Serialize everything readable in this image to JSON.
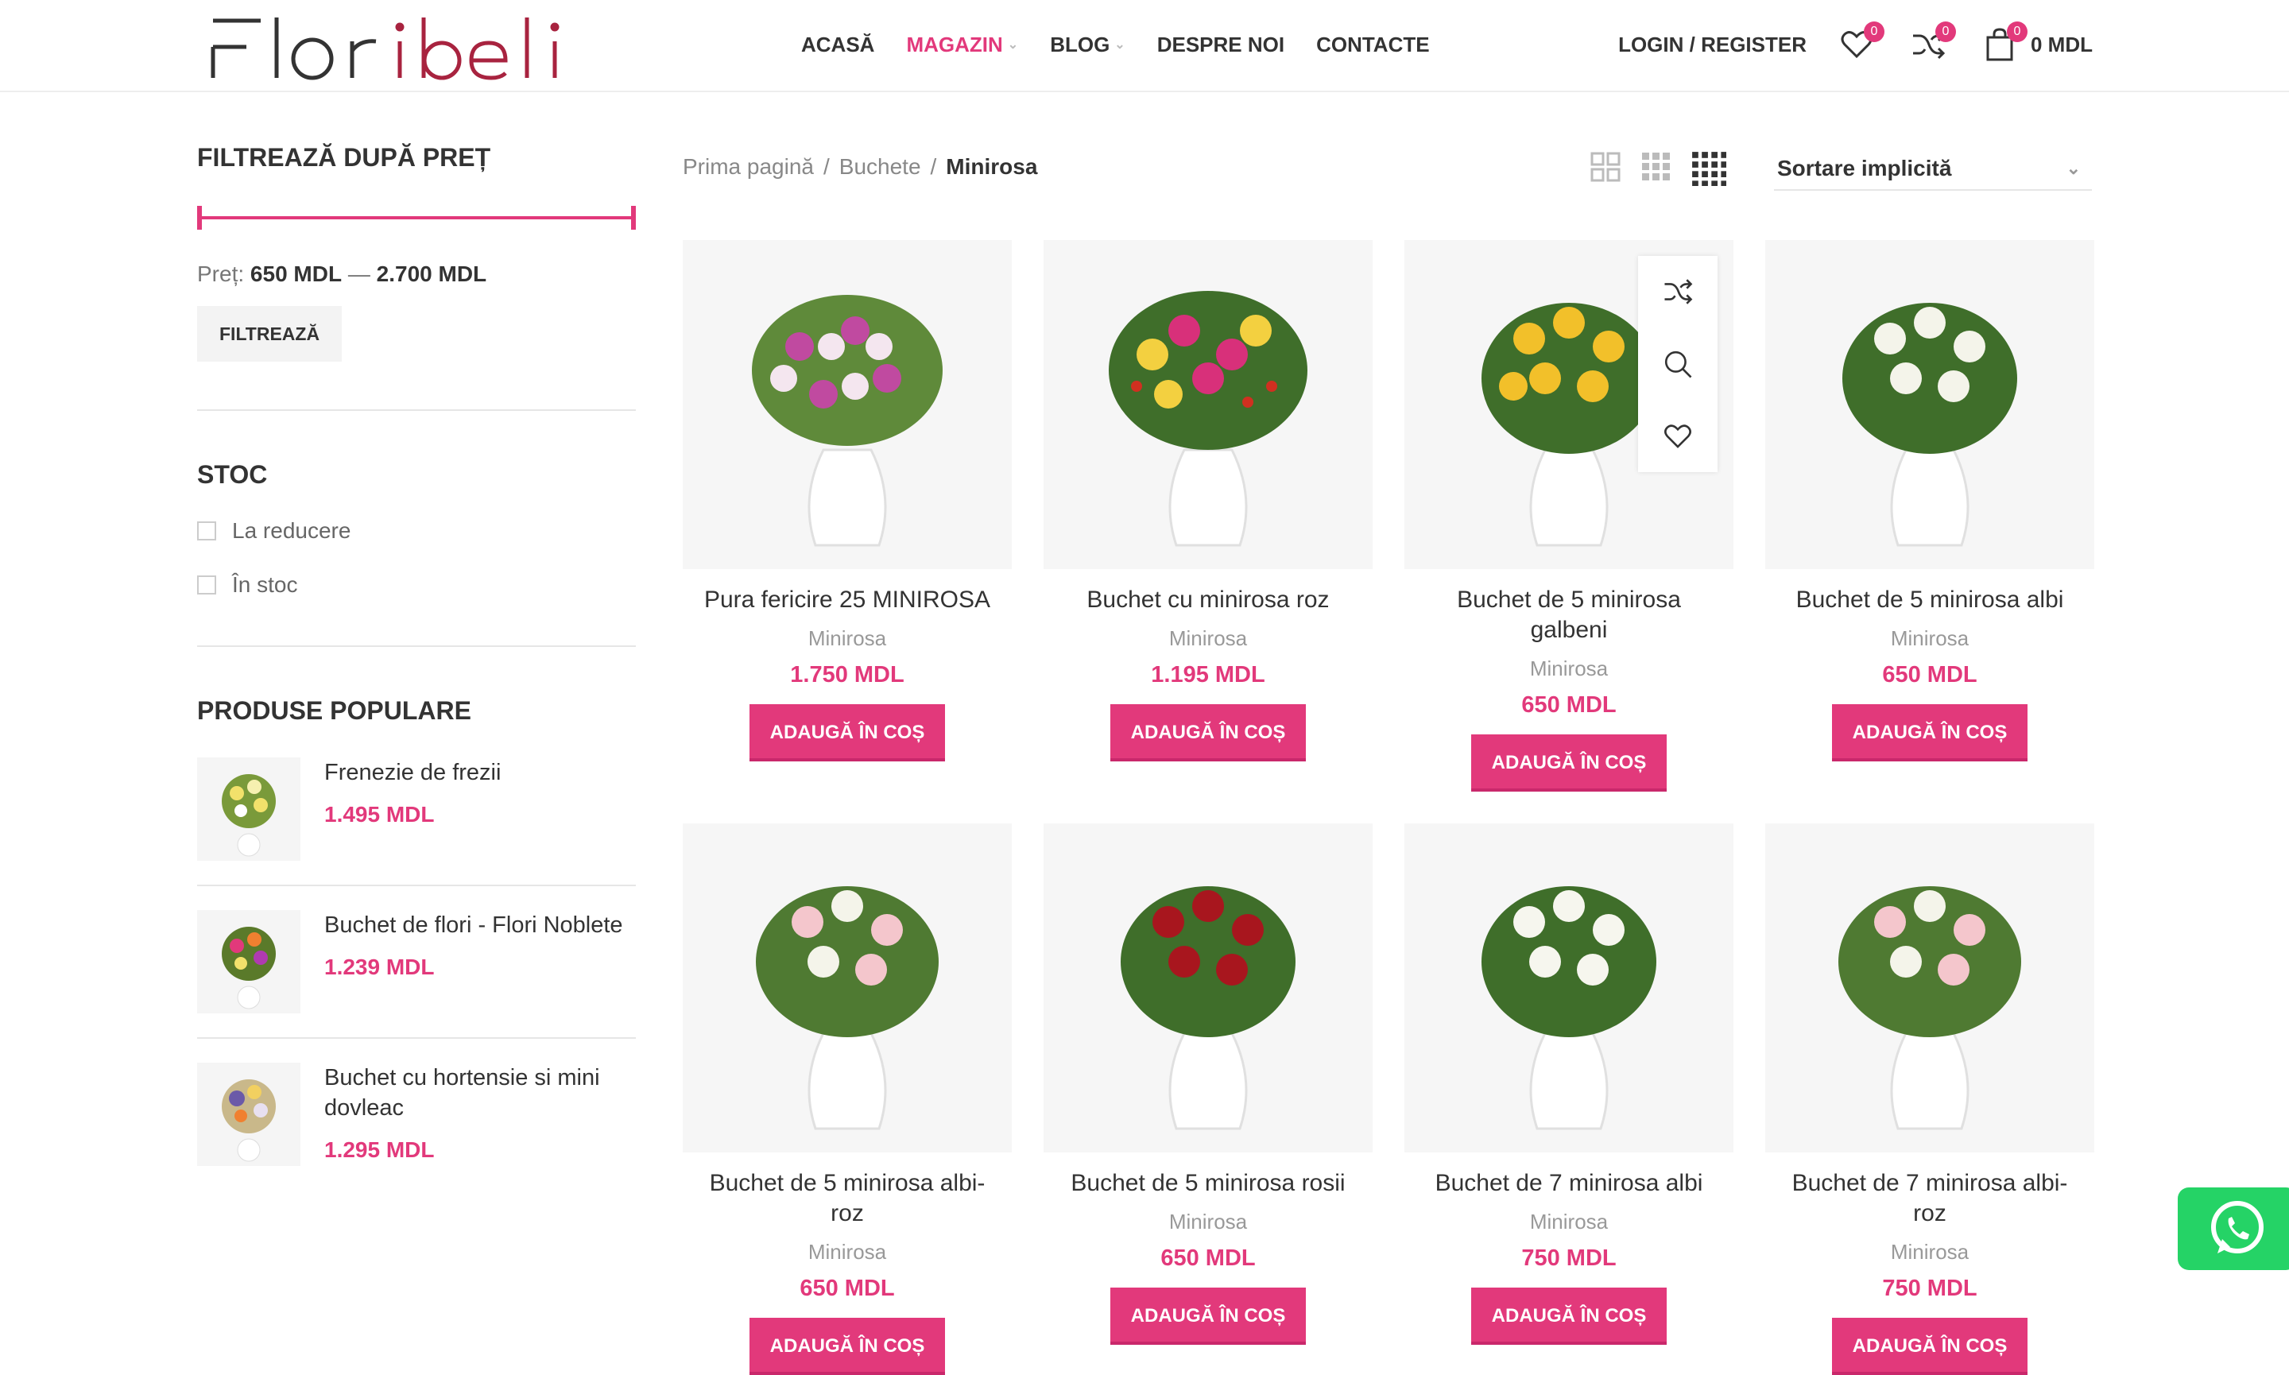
{
  "header": {
    "logo_text": "Floribeli",
    "nav": [
      {
        "label": "ACASĂ",
        "active": false,
        "has_dropdown": false
      },
      {
        "label": "MAGAZIN",
        "active": true,
        "has_dropdown": true
      },
      {
        "label": "BLOG",
        "active": false,
        "has_dropdown": true
      },
      {
        "label": "DESPRE NOI",
        "active": false,
        "has_dropdown": false
      },
      {
        "label": "CONTACTE",
        "active": false,
        "has_dropdown": false
      }
    ],
    "login_label": "LOGIN / REGISTER",
    "wishlist_count": "0",
    "compare_count": "0",
    "cart_count": "0",
    "cart_total": "0 MDL"
  },
  "sidebar": {
    "price_filter": {
      "title": "FILTREAZĂ DUPĂ PREȚ",
      "price_label": "Preț:",
      "min": "650 MDL",
      "dash": "—",
      "max": "2.700 MDL",
      "button": "FILTREAZĂ"
    },
    "stock": {
      "title": "STOC",
      "options": [
        "La reducere",
        "În stoc"
      ]
    },
    "popular": {
      "title": "PRODUSE POPULARE",
      "items": [
        {
          "name": "Frenezie de frezii",
          "price": "1.495 MDL"
        },
        {
          "name": "Buchet de flori - Flori Noblete",
          "price": "1.239 MDL"
        },
        {
          "name": "Buchet cu hortensie si mini dovleac",
          "price": "1.295 MDL"
        }
      ]
    }
  },
  "breadcrumb": {
    "items": [
      "Prima pagină",
      "Buchete",
      "Minirosa"
    ],
    "separator": "/"
  },
  "sort": {
    "selected": "Sortare implicită"
  },
  "products": [
    {
      "title": "Pura fericire 25 MINIROSA",
      "category": "Minirosa",
      "price": "1.750 MDL",
      "button": "ADAUGĂ ÎN COȘ"
    },
    {
      "title": "Buchet cu minirosa roz",
      "category": "Minirosa",
      "price": "1.195 MDL",
      "button": "ADAUGĂ ÎN COȘ"
    },
    {
      "title": "Buchet de 5 minirosa galbeni",
      "category": "Minirosa",
      "price": "650 MDL",
      "button": "ADAUGĂ ÎN COȘ"
    },
    {
      "title": "Buchet de 5 minirosa albi",
      "category": "Minirosa",
      "price": "650 MDL",
      "button": "ADAUGĂ ÎN COȘ"
    },
    {
      "title": "Buchet de 5 minirosa albi-roz",
      "category": "Minirosa",
      "price": "650 MDL",
      "button": "ADAUGĂ ÎN COȘ"
    },
    {
      "title": "Buchet de 5 minirosa rosii",
      "category": "Minirosa",
      "price": "650 MDL",
      "button": "ADAUGĂ ÎN COȘ"
    },
    {
      "title": "Buchet de 7 minirosa albi",
      "category": "Minirosa",
      "price": "750 MDL",
      "button": "ADAUGĂ ÎN COȘ"
    },
    {
      "title": "Buchet de 7 minirosa albi-roz",
      "category": "Minirosa",
      "price": "750 MDL",
      "button": "ADAUGĂ ÎN COȘ"
    }
  ],
  "colors": {
    "accent": "#e2397b",
    "whatsapp": "#25d366"
  }
}
